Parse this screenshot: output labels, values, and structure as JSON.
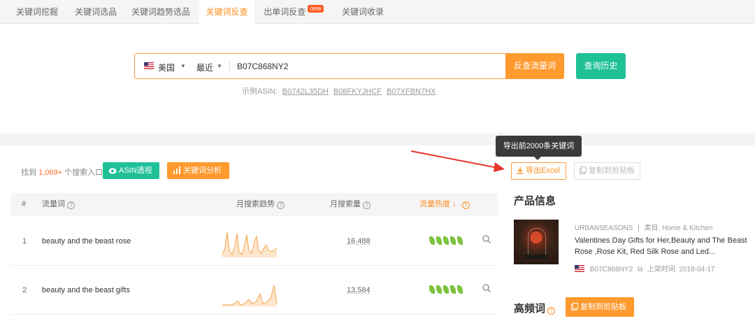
{
  "tabs": [
    {
      "label": "关键词挖掘"
    },
    {
      "label": "关键词选品"
    },
    {
      "label": "关键词趋势选品"
    },
    {
      "label": "关键词反查"
    },
    {
      "label": "出单词反查",
      "badge": "new"
    },
    {
      "label": "关键词收录"
    }
  ],
  "search": {
    "country": "美国",
    "period": "最近",
    "asin_value": "B07C868NY2",
    "reverse_button": "反查流量词",
    "history_button": "查询历史",
    "examples_label": "示例ASIN:",
    "examples": [
      "B0742L35DH",
      "B08FKYJHCF",
      "B07XFBN7HX"
    ]
  },
  "results": {
    "found_prefix": "找到",
    "found_count": "1,069+",
    "found_suffix": "个搜索入口",
    "asin_button": "ASIN透视",
    "analysis_button": "关键词分析",
    "columns": {
      "index": "#",
      "keyword": "流量词",
      "trend": "月搜索趋势",
      "volume": "月搜索量",
      "heat": "流量热度"
    },
    "rows": [
      {
        "rank": "1",
        "keyword": "beauty and the beast rose",
        "volume": "16,488",
        "heat": 5
      },
      {
        "rank": "2",
        "keyword": "beauty and the beast gifts",
        "volume": "13,584",
        "heat": 5
      }
    ]
  },
  "export": {
    "tooltip": "导出前2000条关键词",
    "excel_button": "导出Excel",
    "copy_button": "复制到剪贴板"
  },
  "product": {
    "section_title": "产品信息",
    "brand": "URBANSEASONS",
    "category": "类目: Home & Kitchen",
    "title": "Valentines Day Gifts for Her,Beauty and The Beast Rose ,Rose Kit, Red Silk Rose and Led...",
    "asin": "B07C868NY2",
    "listed": "上架时间: 2018-04-17"
  },
  "high_freq": {
    "title": "高频词",
    "copy_button": "复制到剪贴板"
  },
  "colors": {
    "accent_orange": "#ff9a2e",
    "accent_green": "#20c197",
    "leaf_green": "#7cc23e"
  }
}
